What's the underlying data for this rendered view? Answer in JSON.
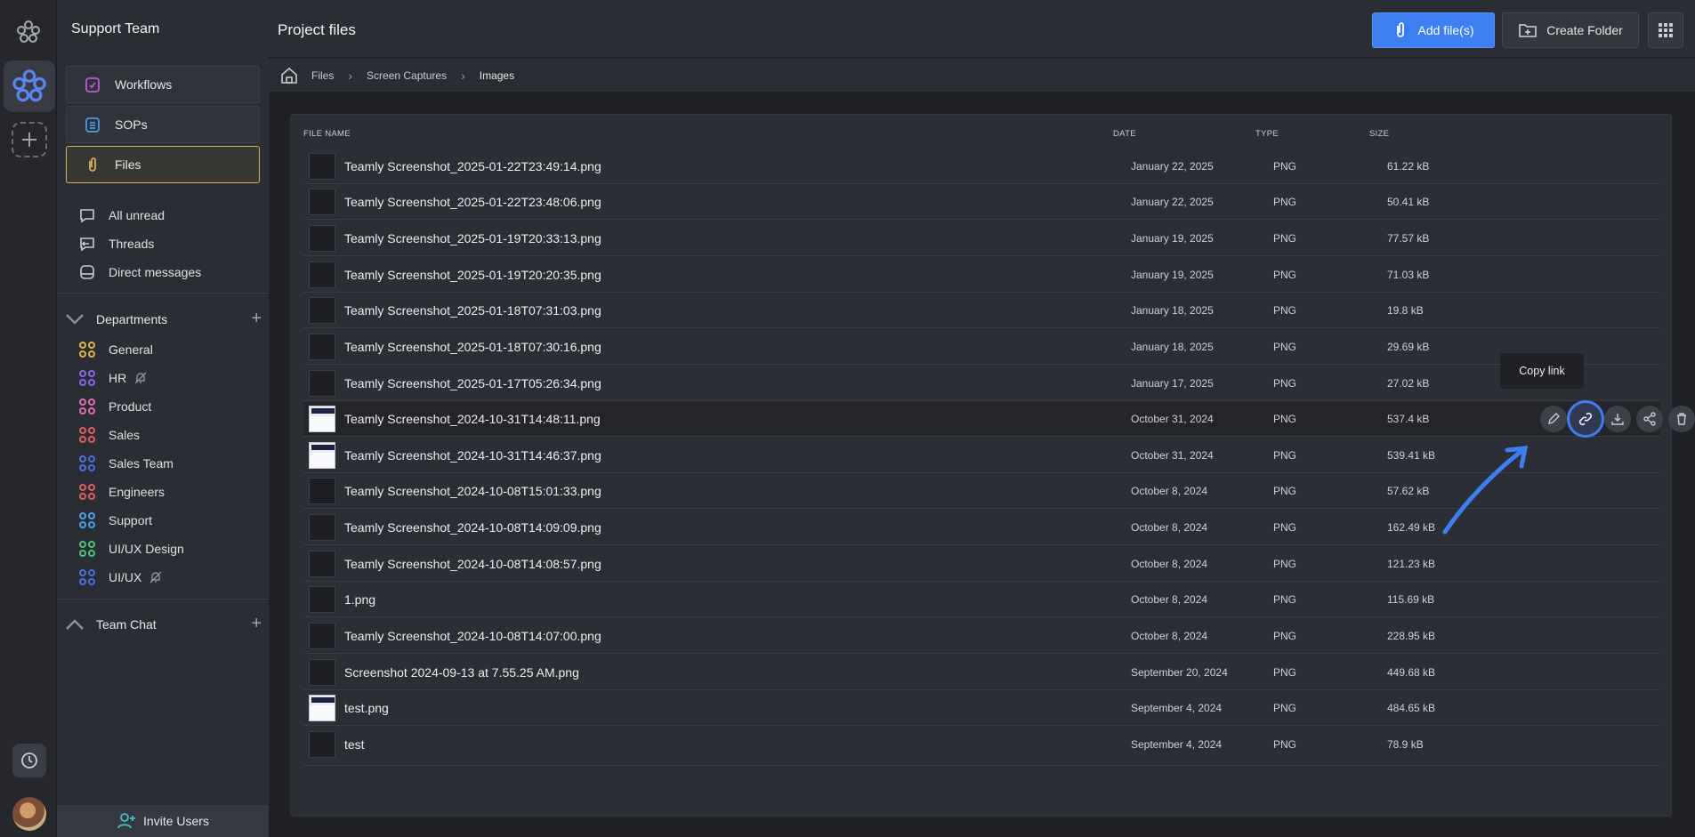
{
  "sidebar": {
    "team_name": "Support Team",
    "nav": [
      {
        "label": "Workflows"
      },
      {
        "label": "SOPs"
      },
      {
        "label": "Files"
      }
    ],
    "links": [
      {
        "label": "All unread"
      },
      {
        "label": "Threads"
      },
      {
        "label": "Direct messages"
      }
    ],
    "departments_title": "Departments",
    "departments": [
      {
        "label": "General",
        "color": "#e3b341"
      },
      {
        "label": "HR",
        "color": "#8a63e6",
        "muted": true
      },
      {
        "label": "Product",
        "color": "#e46ab4"
      },
      {
        "label": "Sales",
        "color": "#e35b5b"
      },
      {
        "label": "Sales Team",
        "color": "#4a6ee6"
      },
      {
        "label": "Engineers",
        "color": "#e35b5b"
      },
      {
        "label": "Support",
        "color": "#4aa3e6"
      },
      {
        "label": "UI/UX Design",
        "color": "#4bc27a"
      },
      {
        "label": "UI/UX",
        "color": "#4a6ee6",
        "muted": true
      }
    ],
    "team_chat_title": "Team Chat",
    "invite_label": "Invite Users"
  },
  "header": {
    "title": "Project files",
    "add_files_label": "Add file(s)",
    "create_folder_label": "Create Folder"
  },
  "breadcrumb": [
    "Files",
    "Screen Captures",
    "Images"
  ],
  "table": {
    "columns": [
      "FILE NAME",
      "DATE",
      "TYPE",
      "SIZE"
    ],
    "rows": [
      {
        "name": "Teamly Screenshot_2025-01-22T23:49:14.png",
        "date": "January 22, 2025",
        "type": "PNG",
        "size": "61.22 kB",
        "thumb": "dark"
      },
      {
        "name": "Teamly Screenshot_2025-01-22T23:48:06.png",
        "date": "January 22, 2025",
        "type": "PNG",
        "size": "50.41 kB",
        "thumb": "dark"
      },
      {
        "name": "Teamly Screenshot_2025-01-19T20:33:13.png",
        "date": "January 19, 2025",
        "type": "PNG",
        "size": "77.57 kB",
        "thumb": "dark"
      },
      {
        "name": "Teamly Screenshot_2025-01-19T20:20:35.png",
        "date": "January 19, 2025",
        "type": "PNG",
        "size": "71.03 kB",
        "thumb": "dark"
      },
      {
        "name": "Teamly Screenshot_2025-01-18T07:31:03.png",
        "date": "January 18, 2025",
        "type": "PNG",
        "size": "19.8 kB",
        "thumb": "dark"
      },
      {
        "name": "Teamly Screenshot_2025-01-18T07:30:16.png",
        "date": "January 18, 2025",
        "type": "PNG",
        "size": "29.69 kB",
        "thumb": "dark"
      },
      {
        "name": "Teamly Screenshot_2025-01-17T05:26:34.png",
        "date": "January 17, 2025",
        "type": "PNG",
        "size": "27.02 kB",
        "thumb": "dark"
      },
      {
        "name": "Teamly Screenshot_2024-10-31T14:48:11.png",
        "date": "October 31, 2024",
        "type": "PNG",
        "size": "537.4 kB",
        "thumb": "light"
      },
      {
        "name": "Teamly Screenshot_2024-10-31T14:46:37.png",
        "date": "October 31, 2024",
        "type": "PNG",
        "size": "539.41 kB",
        "thumb": "light"
      },
      {
        "name": "Teamly Screenshot_2024-10-08T15:01:33.png",
        "date": "October 8, 2024",
        "type": "PNG",
        "size": "57.62 kB",
        "thumb": "dark"
      },
      {
        "name": "Teamly Screenshot_2024-10-08T14:09:09.png",
        "date": "October 8, 2024",
        "type": "PNG",
        "size": "162.49 kB",
        "thumb": "dark"
      },
      {
        "name": "Teamly Screenshot_2024-10-08T14:08:57.png",
        "date": "October 8, 2024",
        "type": "PNG",
        "size": "121.23 kB",
        "thumb": "dark"
      },
      {
        "name": "1.png",
        "date": "October 8, 2024",
        "type": "PNG",
        "size": "115.69 kB",
        "thumb": "dark"
      },
      {
        "name": "Teamly Screenshot_2024-10-08T14:07:00.png",
        "date": "October 8, 2024",
        "type": "PNG",
        "size": "228.95 kB",
        "thumb": "dark"
      },
      {
        "name": "Screenshot 2024-09-13 at 7.55.25 AM.png",
        "date": "September 20, 2024",
        "type": "PNG",
        "size": "449.68 kB",
        "thumb": "dark"
      },
      {
        "name": "test.png",
        "date": "September 4, 2024",
        "type": "PNG",
        "size": "484.65 kB",
        "thumb": "light"
      },
      {
        "name": "test",
        "date": "September 4, 2024",
        "type": "PNG",
        "size": "78.9 kB",
        "thumb": "dark"
      }
    ]
  },
  "tooltip": "Copy link",
  "accent_color": "#3d7ff1"
}
